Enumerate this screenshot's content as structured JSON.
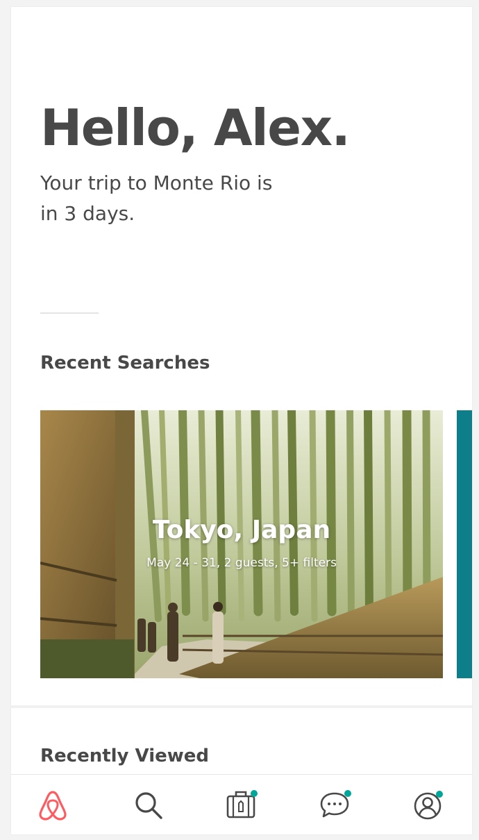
{
  "header": {
    "greeting": "Hello, Alex.",
    "trip_line_1": "Your trip to Monte Rio is",
    "trip_line_2": "in 3 days."
  },
  "recent_searches": {
    "label": "Recent Searches",
    "items": [
      {
        "title": "Tokyo, Japan",
        "details": "May 24 - 31, 2 guests, 5+ filters"
      }
    ]
  },
  "recently_viewed": {
    "label": "Recently Viewed"
  },
  "tabbar": {
    "items": [
      {
        "icon": "airbnb-logo-icon",
        "active": true
      },
      {
        "icon": "search-icon"
      },
      {
        "icon": "trips-icon",
        "badge": true
      },
      {
        "icon": "messages-icon",
        "badge": true
      },
      {
        "icon": "profile-icon",
        "badge": true
      }
    ]
  },
  "colors": {
    "brand": "#ff5a5f",
    "badge": "#00a699",
    "teal_card": "#0e7f8a",
    "text": "#484848"
  }
}
